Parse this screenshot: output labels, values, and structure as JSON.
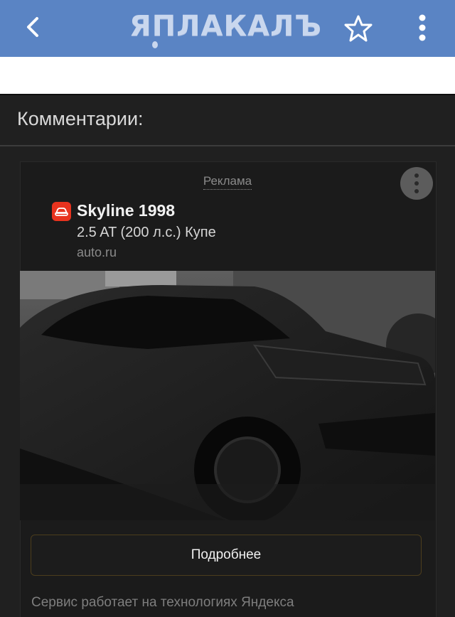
{
  "app": {
    "logo_text": "ЯПЛАКАЛЪ",
    "back_icon": "chevron-left-icon",
    "favorite_icon": "star-outline-icon",
    "menu_icon": "more-vertical-icon",
    "header_color": "#5a84c4"
  },
  "comments": {
    "title": "Комментарии:"
  },
  "ad": {
    "label": "Реклама",
    "title": "Skyline 1998",
    "subtitle": "2.5 AT (200 л.с.) Купе",
    "domain": "auto.ru",
    "brand_icon": "car-icon",
    "brand_color": "#e8331e",
    "image_alt": "black car photo",
    "cta_label": "Подробнее",
    "disclaimer": "Сервис работает на технологиях Яндекса"
  }
}
